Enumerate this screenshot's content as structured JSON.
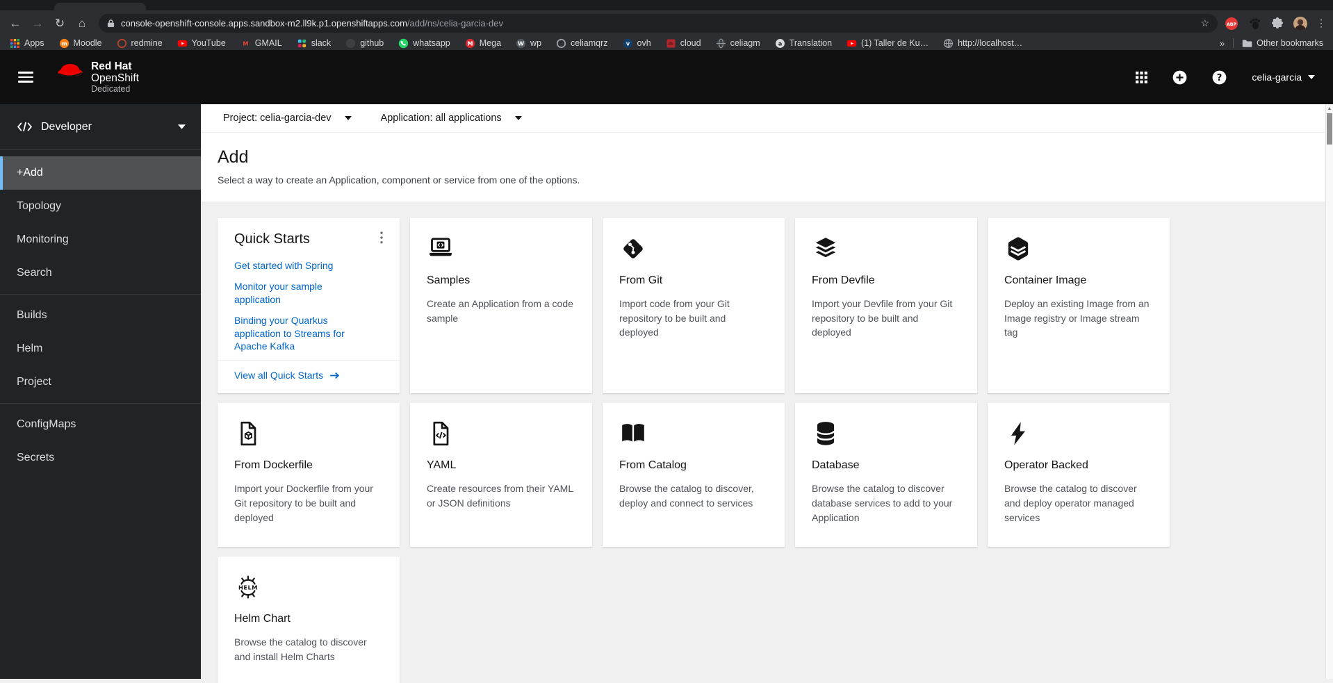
{
  "colors": {
    "accent_link": "#0066cc",
    "nav_active_border": "#73bcf7",
    "masthead_bg": "#0f0f0f",
    "sidebar_bg": "#212427",
    "brand_red": "#ee0000"
  },
  "browser": {
    "url_domain": "console-openshift-console.apps.sandbox-m2.ll9k.p1.openshiftapps.com",
    "url_path": "/add/ns/celia-garcia-dev",
    "apps_label": "Apps",
    "bookmarks": [
      {
        "label": "Moodle",
        "icon": "moodle-favicon",
        "color": "#f98012",
        "letter": "m"
      },
      {
        "label": "redmine",
        "icon": "redmine-favicon",
        "color": "#b5452f"
      },
      {
        "label": "YouTube",
        "icon": "youtube-favicon",
        "color": "#ff0000"
      },
      {
        "label": "GMAIL",
        "icon": "gmail-favicon",
        "color": "#ea4335"
      },
      {
        "label": "slack",
        "icon": "slack-favicon",
        "color": "#611f69"
      },
      {
        "label": "github",
        "icon": "github-favicon",
        "color": "#3c4043"
      },
      {
        "label": "whatsapp",
        "icon": "whatsapp-favicon",
        "color": "#25d366"
      },
      {
        "label": "Mega",
        "icon": "mega-favicon",
        "color": "#d9272e",
        "letter": "M"
      },
      {
        "label": "wp",
        "icon": "wordpress-favicon",
        "color": "#50575e",
        "letter": "W"
      },
      {
        "label": "celiamqrz",
        "icon": "clock-favicon",
        "color": "#9aa0a6"
      },
      {
        "label": "ovh",
        "icon": "ovh-favicon",
        "color": "#123f6d",
        "letter": "v"
      },
      {
        "label": "cloud",
        "icon": "cloud-favicon",
        "color": "#b3282d"
      },
      {
        "label": "celiagm",
        "icon": "globe-dark-favicon",
        "color": "#5f6368"
      },
      {
        "label": "Translation",
        "icon": "translation-favicon",
        "color": "#dadce0",
        "letter": "a"
      },
      {
        "label": "(1) Taller de Ku…",
        "icon": "youtube-favicon",
        "color": "#ff0000"
      },
      {
        "label": "http://localhost…",
        "icon": "globe-favicon",
        "color": "#9aa0a6"
      }
    ],
    "overflow_chevron": "»",
    "other_bookmarks": "Other bookmarks"
  },
  "masthead": {
    "brand1": "Red Hat",
    "brand2": "OpenShift",
    "brand3": "Dedicated",
    "user": "celia-garcia"
  },
  "sidebar": {
    "perspective": "Developer",
    "items": [
      {
        "label": "+Add",
        "active": true
      },
      {
        "label": "Topology"
      },
      {
        "label": "Monitoring"
      },
      {
        "label": "Search"
      },
      {
        "label": "Builds",
        "divider_before": true
      },
      {
        "label": "Helm"
      },
      {
        "label": "Project"
      },
      {
        "label": "ConfigMaps",
        "divider_before": true
      },
      {
        "label": "Secrets"
      }
    ]
  },
  "context": {
    "project": "Project: celia-garcia-dev",
    "application": "Application: all applications"
  },
  "page": {
    "title": "Add",
    "description": "Select a way to create an Application, component or service from one of the options."
  },
  "quick_starts": {
    "title": "Quick Starts",
    "links": [
      "Get started with Spring",
      "Monitor your sample application",
      "Binding your Quarkus application to Streams for Apache Kafka"
    ],
    "footer": "View all Quick Starts"
  },
  "cards": [
    {
      "title": "Samples",
      "icon": "laptop-code-icon",
      "description": "Create an Application from a code sample"
    },
    {
      "title": "From Git",
      "icon": "git-icon",
      "description": "Import code from your Git repository to be built and deployed"
    },
    {
      "title": "From Devfile",
      "icon": "layers-icon",
      "description": "Import your Devfile from your Git repository to be built and deployed"
    },
    {
      "title": "Container Image",
      "icon": "cube-layers-icon",
      "description": "Deploy an existing Image from an Image registry or Image stream tag"
    },
    {
      "title": "From Dockerfile",
      "icon": "file-cube-icon",
      "description": "Import your Dockerfile from your Git repository to be built and deployed"
    },
    {
      "title": "YAML",
      "icon": "file-code-icon",
      "description": "Create resources from their YAML or JSON definitions"
    },
    {
      "title": "From Catalog",
      "icon": "open-book-icon",
      "description": "Browse the catalog to discover, deploy and connect to services"
    },
    {
      "title": "Database",
      "icon": "database-icon",
      "description": "Browse the catalog to discover database services to add to your Application"
    },
    {
      "title": "Operator Backed",
      "icon": "bolt-icon",
      "description": "Browse the catalog to discover and deploy operator managed services"
    },
    {
      "title": "Helm Chart",
      "icon": "helm-icon",
      "description": "Browse the catalog to discover and install Helm Charts"
    }
  ]
}
